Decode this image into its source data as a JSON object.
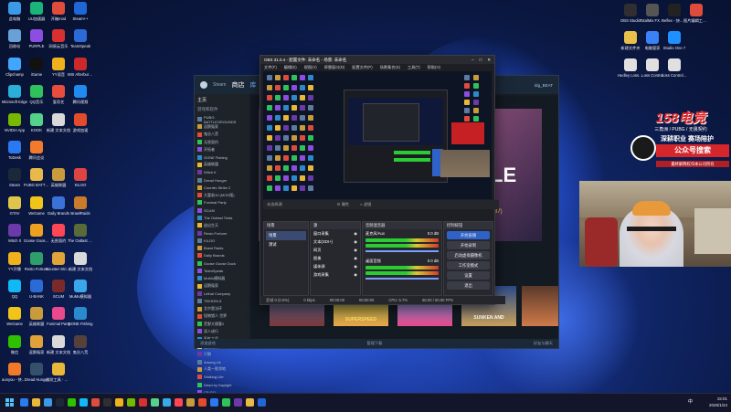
{
  "desktop_icons_left": [
    {
      "label": "此电脑",
      "color": "#3a9ae8"
    },
    {
      "label": "UU加速器",
      "color": "#1ab37a"
    },
    {
      "label": "开箱mod",
      "color": "#e04c3c"
    },
    {
      "label": "Steam++",
      "color": "#1f66d6"
    },
    {
      "label": "回收站",
      "color": "#6aa0d8"
    },
    {
      "label": "PURPLE",
      "color": "#8d4de0"
    },
    {
      "label": "网易云音乐",
      "color": "#d83030"
    },
    {
      "label": "TeamSpeak",
      "color": "#2c6ad8"
    },
    {
      "label": "Clipchamp",
      "color": "#41a6ff"
    },
    {
      "label": "iGame",
      "color": "#111111"
    },
    {
      "label": "YY语音",
      "color": "#f0b21c"
    },
    {
      "label": "MSI Afterburner",
      "color": "#cc2a2a"
    },
    {
      "label": "Microsoft Edge",
      "color": "#2ab0d8"
    },
    {
      "label": "QQ音乐",
      "color": "#2fc25b"
    },
    {
      "label": "爱奇艺",
      "color": "#e74c3c"
    },
    {
      "label": "腾讯视频",
      "color": "#1f8bf1"
    },
    {
      "label": "NVIDIA App",
      "color": "#76b900"
    },
    {
      "label": "KOOK",
      "color": "#55d18c"
    },
    {
      "label": "新建 文本文档",
      "color": "#d9d9d9"
    },
    {
      "label": "游戏加速",
      "color": "#e24b2c"
    },
    {
      "label": "ToDesk",
      "color": "#2a79f0"
    },
    {
      "label": "腾讯会议",
      "color": "#f27a2c"
    },
    {
      "label": "",
      "color": "transparent"
    },
    {
      "label": "",
      "color": "transparent"
    },
    {
      "label": "Steam",
      "color": "#1b2838"
    },
    {
      "label": "PUBG BATTLEGR...",
      "color": "#e7b84a"
    },
    {
      "label": "英雄联盟",
      "color": "#c89b3c"
    },
    {
      "label": "KILOO",
      "color": "#d44"
    },
    {
      "label": "GTAV",
      "color": "#e1c44b"
    },
    {
      "label": "WeGame",
      "color": "#f0c419"
    },
    {
      "label": "Daily Brands",
      "color": "#3a72d8"
    },
    {
      "label": "BrawlRaids",
      "color": "#c97a2a"
    },
    {
      "label": "Witch It",
      "color": "#6b3aa8"
    },
    {
      "label": "Goose Goose Duck",
      "color": "#f0a020"
    },
    {
      "label": "无畏契约",
      "color": "#ff4655"
    },
    {
      "label": "The Outlast Trials",
      "color": "#5a6b3a"
    },
    {
      "label": "YY开播",
      "color": "#f0b21c"
    },
    {
      "label": "Resto Fortune",
      "color": "#2f9e6a"
    },
    {
      "label": "Counter-Strike 2",
      "color": "#e0a43a"
    },
    {
      "label": "新建 文本文档",
      "color": "#d9d9d9"
    },
    {
      "label": "QQ",
      "color": "#12b7f5"
    },
    {
      "label": "U-BANK",
      "color": "#2a6bd6"
    },
    {
      "label": "SCUM",
      "color": "#7a2a2a"
    },
    {
      "label": "MuMu模拟器",
      "color": "#3aa8e8"
    },
    {
      "label": "WeGame",
      "color": "#f0c419"
    },
    {
      "label": "英雄联盟",
      "color": "#c89b3c"
    },
    {
      "label": "Funimal Party",
      "color": "#e84a8c"
    },
    {
      "label": "GONE Fishing",
      "color": "#2a8acb"
    },
    {
      "label": "微信",
      "color": "#2dc100"
    },
    {
      "label": "逗鹅冤家",
      "color": "#e0a13a"
    },
    {
      "label": "新建 文本文档",
      "color": "#d9d9d9"
    },
    {
      "label": "鬼谷八荒",
      "color": "#55413a"
    },
    {
      "label": "aunyou - 快捷方式",
      "color": "#f07a2a"
    },
    {
      "label": "Dread Hunger",
      "color": "#34506b"
    },
    {
      "label": "战纹工具 - 快捷方式",
      "color": "#e8b83a"
    },
    {
      "label": "",
      "color": "transparent"
    }
  ],
  "desktop_icons_right": [
    {
      "label": "OBS Studio",
      "color": "#302e31"
    },
    {
      "label": "TotalMix FX - 快捷方式",
      "color": "#555555"
    },
    {
      "label": "Reflex - 快捷方式",
      "color": "#222"
    },
    {
      "label": "图片编辑工具箱 - 快捷方式",
      "color": "#e04c3c"
    },
    {
      "label": "新建文件夹",
      "color": "#e8c14a"
    },
    {
      "label": "电脑管家",
      "color": "#3b82f6"
    },
    {
      "label": "Studio One 7",
      "color": "#1e90ff"
    },
    {
      "label": "",
      "color": "transparent"
    },
    {
      "label": "Hedley Loss Cont...",
      "color": "#e0e0e0"
    },
    {
      "label": "Loss Control",
      "color": "#e0e0e0"
    },
    {
      "label": "Loss Control-R...",
      "color": "#e0e0e0"
    },
    {
      "label": "",
      "color": "transparent"
    }
  ],
  "steam": {
    "title": "Steam",
    "nav": [
      "商店",
      "库",
      "社区"
    ],
    "username": "ldg_BEAT",
    "home_label": "主页",
    "collection_label": "游戏和软件",
    "games": [
      "PUBG: BATTLEGROUNDS",
      "逗鹅冤家",
      "鬼谷八荒",
      "无畏契约",
      "开拓者",
      "GONE Fishing",
      "英雄联盟",
      "Witch It",
      "Dread Hunger",
      "Counter-Strike 2",
      "大富翁10 (MOD版)",
      "Funimal Party",
      "SCUM",
      "The Outlast Trials",
      "逃出生天",
      "Resto Fortune",
      "KILOO",
      "Brawl Raids",
      "Daily Brands",
      "Goose Goose Duck",
      "TeamSpeak",
      "MuMu模拟器",
      "逗鹅冤家",
      "Lethal Company",
      "TEKKEN 8",
      "艾尔登法环",
      "怪物猎人 世界",
      "荒野大镖客2",
      "双人成行",
      "彩虹六号",
      "猛兽派对",
      "只狼",
      "Among Us",
      "人类一败涂地",
      "Walking Life",
      "Dead by Daylight",
      "CS:GO"
    ],
    "add_game": "添加游戏",
    "manage_downloads": "管理下载",
    "friends_chat": "好友与聊天",
    "featured_text": "LE",
    "price": "(37)",
    "thumbs": [
      "SUPERSPEED",
      "SUNKEN AND"
    ]
  },
  "obs": {
    "title": "OBS 31.0.4 - 配置文件: 未命名 - 场景: 未命名",
    "menus": [
      "文件(F)",
      "编辑(E)",
      "视图(V)",
      "停靠窗口(D)",
      "配置文件(P)",
      "场景集合(S)",
      "工具(T)",
      "帮助(H)"
    ],
    "source_label": "未选择源",
    "props": "属性",
    "filters": "滤镜",
    "docks": {
      "scenes": {
        "title": "场景",
        "items": [
          "场景",
          "测试"
        ]
      },
      "sources": {
        "title": "源",
        "items": [
          "窗口采集",
          "文本(GDI+)",
          "网页",
          "图像",
          "媒体源",
          "游戏采集"
        ]
      },
      "mixer": {
        "title": "音频混音器",
        "channels": [
          {
            "name": "麦克风/Aux",
            "db": "0.0 dB"
          },
          {
            "name": "桌面音频",
            "db": "0.0 dB"
          }
        ]
      },
      "controls": {
        "title": "控制按钮",
        "buttons": [
          "开始直播",
          "开始录制",
          "启动虚拟摄像机",
          "工作室模式",
          "设置",
          "退出"
        ],
        "active": 0
      }
    },
    "status": [
      "丢帧 0 (0.0%)",
      "0 kbps",
      "00:00:00",
      "00:00:00",
      "CPU: 5.7%",
      "60.00 / 60.00 FPS"
    ]
  },
  "logo": {
    "text": "158电竞",
    "sub": "三角洲 / PUBG / 无畏契约",
    "line1": "深耕职业 赛场陪护",
    "search": "公众号搜索",
    "bottom": "最终解释权归本公司所有"
  },
  "taskbar": {
    "time": "15:01",
    "date": "2026/1/24",
    "lang": "中",
    "icons": [
      "#2a7bf0",
      "#e8b83a",
      "#3a9ae8",
      "#1b2838",
      "#2dc100",
      "#12b7f5",
      "#e04c3c",
      "#302e31",
      "#f0b21c",
      "#76b900",
      "#d83030",
      "#55d18c",
      "#3aa8e8",
      "#ff4655",
      "#c89b3c",
      "#e24b2c",
      "#2a79f0",
      "#2fc25b",
      "#6b3aa8",
      "#e7b84a",
      "#1f66d6"
    ]
  }
}
